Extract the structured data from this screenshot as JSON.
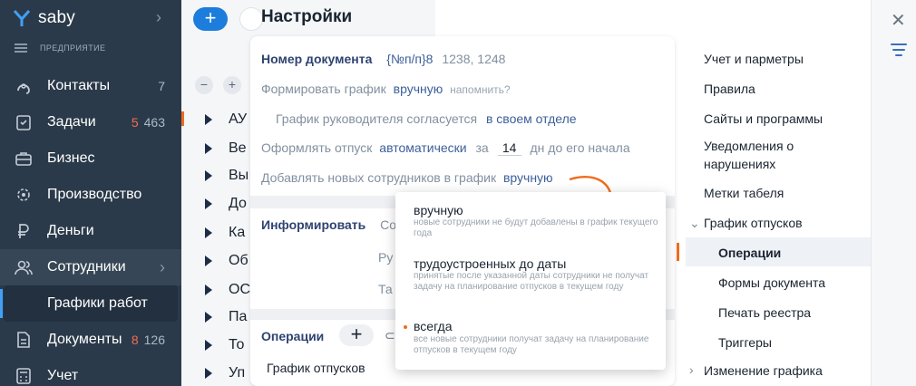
{
  "app": {
    "brand": "saby",
    "section": "ПРЕДПРИЯТИЕ"
  },
  "sidebar": {
    "items": [
      {
        "label": "Контакты",
        "count": "7",
        "icon": "contacts-icon"
      },
      {
        "label": "Задачи",
        "count_red": "5",
        "count": "463",
        "icon": "tasks-icon"
      },
      {
        "label": "Бизнес",
        "icon": "business-icon"
      },
      {
        "label": "Производство",
        "icon": "production-icon"
      },
      {
        "label": "Деньги",
        "icon": "money-icon"
      },
      {
        "label": "Сотрудники",
        "icon": "employees-icon"
      },
      {
        "label": "Документы",
        "count_red": "8",
        "count": "126",
        "icon": "documents-icon"
      },
      {
        "label": "Учет",
        "icon": "accounting-icon"
      }
    ],
    "sub_item": "Графики работ"
  },
  "middle": {
    "rows": [
      "АУ",
      "Ве",
      "Вы",
      "До",
      "Ка",
      "Об",
      "ОС",
      "Па",
      "То",
      "Уп"
    ]
  },
  "settings": {
    "title": "Настройки",
    "doc_number_label": "Номер документа",
    "doc_number_format": "{№п/п}8",
    "doc_number_example": "1238, 1248",
    "schedule_label": "Формировать график",
    "schedule_value": "вручную",
    "schedule_hint": "напомнить?",
    "manager_label": "График руководителя согласуется",
    "manager_value": "в своем отделе",
    "vacation_label": "Оформлять отпуск",
    "vacation_value": "автоматически",
    "vacation_pre": "за",
    "vacation_days": "14",
    "vacation_post": "дн до его начала",
    "add_label": "Добавлять новых сотрудников в график",
    "add_value": "вручную",
    "inform_label": "Информировать",
    "inform_rows": [
      "Со",
      "Ру",
      "Та"
    ],
    "ops_label": "Операции",
    "ops_row": "График отпусков"
  },
  "dropdown": {
    "options": [
      {
        "label": "вручную",
        "desc": "новые сотрудники не будут добавлены в график текущего года",
        "selected": false
      },
      {
        "label": "трудоустроенных до даты",
        "desc": "принятые после указанной даты сотрудники не получат задачу на планирование отпусков в текущем году",
        "selected": false
      },
      {
        "label": "всегда",
        "desc": "все новые сотрудники получат задачу на планирование отпусков в текущем году",
        "selected": true
      }
    ]
  },
  "nav": {
    "items": [
      "Учет и парметры",
      "Правила",
      "Сайты и программы",
      "Уведомления о",
      "нарушениях",
      "Метки табеля",
      "График отпусков",
      "Операции",
      "Формы документа",
      "Печать реестра",
      "Триггеры",
      "Изменение графика"
    ]
  },
  "colors": {
    "accent": "#1c7ddc",
    "marker": "#ef6c1c",
    "sidebar": "#2b3a4a"
  }
}
